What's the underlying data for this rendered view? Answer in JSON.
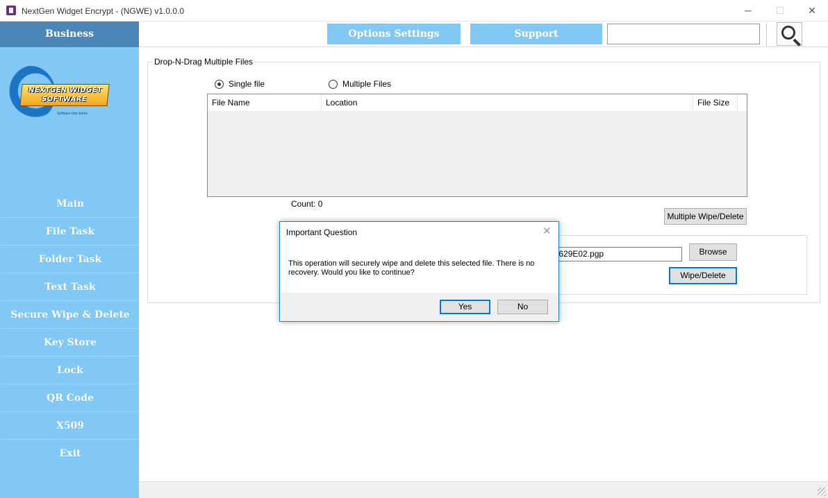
{
  "window": {
    "title": "NextGen Widget Encrypt - (NGWE) v1.0.0.0",
    "minimize": "─",
    "maximize": "☐",
    "close": "✕"
  },
  "sidebar": {
    "header": "Business",
    "logo_line1": "NEXTGEN WIDGET",
    "logo_line2": "SOFTWARE",
    "logo_tagline": "Software that works",
    "items": [
      {
        "label": "Main"
      },
      {
        "label": "File Task"
      },
      {
        "label": "Folder Task"
      },
      {
        "label": "Text Task"
      },
      {
        "label": "Secure Wipe & Delete"
      },
      {
        "label": "Key Store"
      },
      {
        "label": "Lock"
      },
      {
        "label": "QR Code"
      },
      {
        "label": "X509"
      },
      {
        "label": "Exit"
      }
    ]
  },
  "toolbar": {
    "options_label": "Options Settings",
    "support_label": "Support",
    "search_value": ""
  },
  "main": {
    "group_title": "Drop-N-Drag Multiple Files",
    "radio_single": "Single file",
    "radio_multiple": "Multiple Files",
    "columns": {
      "name": "File Name",
      "location": "Location",
      "size": "File Size"
    },
    "count": "Count: 0",
    "multi_wipe_label": "Multiple Wipe/Delete",
    "file_path": "B91629E02.pgp",
    "browse_label": "Browse",
    "wipe_label": "Wipe/Delete"
  },
  "dialog": {
    "title": "Important Question",
    "message": "This operation will securely wipe and delete this selected file. There is no recovery. Would you like to continue?",
    "yes_label": "Yes",
    "no_label": "No",
    "close": "✕"
  },
  "colors": {
    "sidebar": "#82c8f5",
    "sidebar_header": "#4a86b8",
    "accent": "#0078d7"
  }
}
